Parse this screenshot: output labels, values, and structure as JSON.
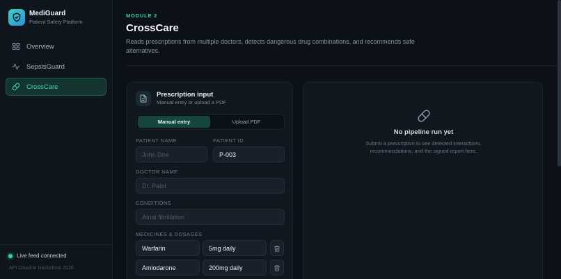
{
  "brand": {
    "name": "MediGuard",
    "subtitle": "Patient Safety Platform"
  },
  "nav": [
    {
      "label": "Overview",
      "icon": "grid-icon",
      "active": false
    },
    {
      "label": "SepsisGuard",
      "icon": "activity-icon",
      "active": false
    },
    {
      "label": "CrossCare",
      "icon": "pill-icon",
      "active": true
    }
  ],
  "footer": {
    "status": "Live feed connected",
    "event": "API Cloud AI Hackathon 2026"
  },
  "header": {
    "module": "MODULE 2",
    "title": "CrossCare",
    "description": "Reads prescriptions from multiple doctors, detects dangerous drug combinations, and recommends safe alternatives."
  },
  "input_card": {
    "title": "Prescription input",
    "subtitle": "Manual entry or upload a PDF",
    "tabs": {
      "manual": "Manual entry",
      "upload": "Upload PDF"
    },
    "fields": {
      "patient_name_label": "PATIENT NAME",
      "patient_name_placeholder": "John Doe",
      "patient_id_label": "PATIENT ID",
      "patient_id_value": "P-003",
      "doctor_name_label": "DOCTOR NAME",
      "doctor_name_placeholder": "Dr. Patel",
      "conditions_label": "CONDITIONS",
      "conditions_placeholder": "Atrial fibrillation",
      "medicines_label": "MEDICINES & DOSAGES"
    },
    "medicines": [
      {
        "name": "Warfarin",
        "dosage": "5mg daily"
      },
      {
        "name": "Amiodarone",
        "dosage": "200mg daily"
      }
    ]
  },
  "result_card": {
    "empty_title": "No pipeline run yet",
    "empty_desc": "Submit a prescription to see detected interactions, recommendations, and the signed report here."
  },
  "colors": {
    "accent": "#3fcfb6",
    "bg": "#0c1117",
    "live": "#34d399"
  }
}
